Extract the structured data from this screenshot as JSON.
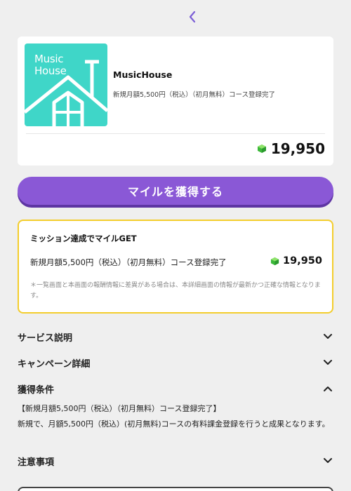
{
  "header": {
    "back_icon": "chevron-left-icon",
    "accent_color": "#7b5ed6"
  },
  "offer": {
    "thumbnail_logo_line1": "Music",
    "thumbnail_logo_line2": "House",
    "thumbnail_color": "#3fd6c8",
    "service_name": "MusicHouse",
    "description": "新規月額5,500円（税込）（初月無料）コース登録完了",
    "points": "19,950",
    "points_icon": "green-gem-icon"
  },
  "get_button": {
    "label": "マイルを獲得する",
    "color": "#8a58d6"
  },
  "mission": {
    "title": "ミッション達成でマイルGET",
    "row_label": "新規月額5,500円（税込）（初月無料）コース登録完了",
    "row_points": "19,950",
    "note": "＊一覧画面と本画面の報酬情報に差異がある場合は、本詳細画面の情報が最新かつ正確な情報となります。",
    "border_color": "#f3cd2c"
  },
  "sections": {
    "service_description": {
      "title": "サービス説明",
      "icon": "chevron-down-icon"
    },
    "campaign_details": {
      "title": "キャンペーン詳細",
      "icon": "chevron-down-icon"
    },
    "conditions": {
      "title": "獲得条件",
      "icon": "chevron-up-icon",
      "heading": "【新規月額5,500円（税込）（初月無料）コース登録完了】",
      "body": "新規で、月額5,500円（税込）(初月無料)コースの有料課金登録を行うと成果となります。"
    },
    "notes": {
      "title": "注意事項",
      "icon": "chevron-down-icon"
    }
  }
}
